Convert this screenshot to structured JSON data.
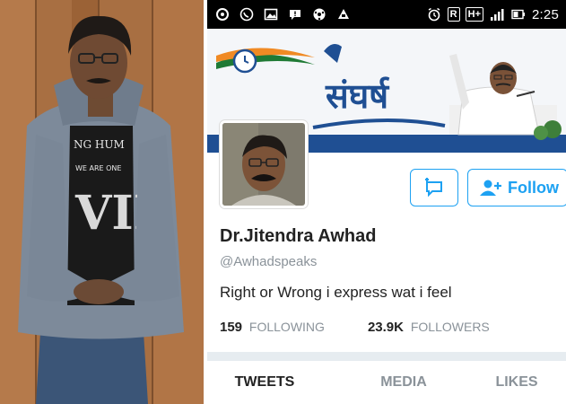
{
  "status_bar": {
    "time": "2:25",
    "network_label": "H+",
    "sim_label": "R",
    "left_icons": [
      "settings-icon",
      "whatsapp-icon",
      "gallery-icon",
      "chat-icon",
      "soccer-icon",
      "upload-icon"
    ],
    "right_icons": [
      "alarm-icon",
      "sim-icon",
      "network-type-icon",
      "signal-icon",
      "battery-icon"
    ]
  },
  "left_photo": {
    "shirt_text_line1": "NG HUM",
    "shirt_text_line2": "WE ARE ONE",
    "shirt_text_big": "VII"
  },
  "profile": {
    "banner_title": "संघर्ष",
    "name": "Dr.Jitendra Awhad",
    "handle": "@Awhadspeaks",
    "bio": "Right or Wrong i express wat i feel",
    "following_count": "159",
    "following_label": "FOLLOWING",
    "followers_count": "23.9K",
    "followers_label": "FOLLOWERS",
    "follow_button_label": "Follow"
  },
  "tabs": [
    {
      "label": "TWEETS",
      "active": true
    },
    {
      "label": "MEDIA",
      "active": false
    },
    {
      "label": "LIKES",
      "active": false
    }
  ],
  "colors": {
    "accent": "#1da1f2",
    "banner_blue": "#1f4f93",
    "wall_brown": "#a26a3f"
  }
}
